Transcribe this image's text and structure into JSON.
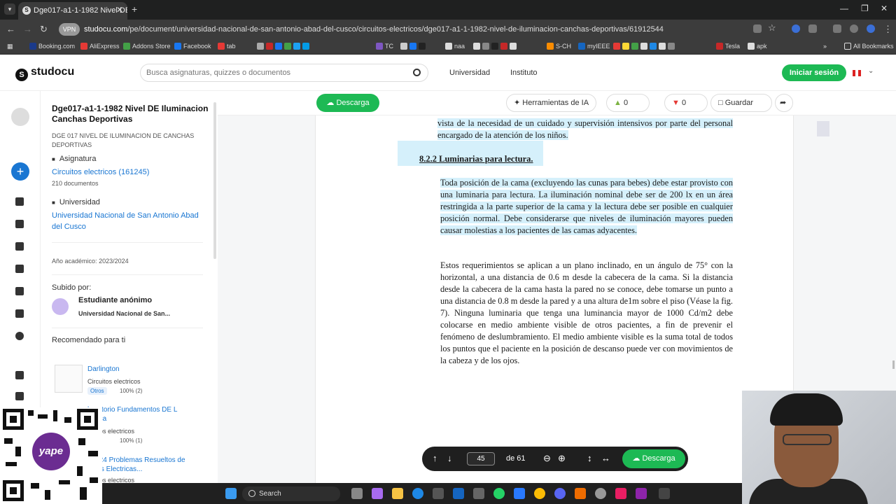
{
  "browser": {
    "tab_title": "Dge017-a1-1-1982 Nivel DE Ilu",
    "url_host": "studocu.com",
    "url_path": "/pe/document/universidad-nacional-de-san-antonio-abad-del-cusco/circuitos-electricos/dge017-a1-1-1982-nivel-de-iluminacion-canchas-deportivas/61912544",
    "vpn_label": "VPN",
    "bookmarks": [
      "Booking.com",
      "AliExpress",
      "Addons Store",
      "Facebook",
      "tab",
      "TC",
      "naa",
      "S-CH",
      "myIEEE",
      "Tesla",
      "apk"
    ],
    "all_bookmarks": "All Bookmarks"
  },
  "header": {
    "logo": "studocu",
    "search_placeholder": "Busca asignaturas, quizzes o documentos",
    "link_university": "Universidad",
    "link_institute": "Instituto",
    "login": "Iniciar sesión"
  },
  "sidebar": {
    "title": "Dge017-a1-1-1982 Nivel DE Iluminacion Canchas Deportivas",
    "subtitle": "DGE 017 NIVEL DE ILUMINACION DE CANCHAS DEPORTIVAS",
    "subject_label": "Asignatura",
    "subject": "Circuitos electricos (161245)",
    "doc_count": "210 documentos",
    "university_label": "Universidad",
    "university": "Universidad Nacional de San Antonio Abad del Cusco",
    "academic_year_label": "Año académico:",
    "academic_year": "2023/2024",
    "uploaded_by": "Subido por:",
    "uploader_name": "Estudiante anónimo",
    "uploader_uni": "Universidad Nacional de San...",
    "recommended": "Recomendado para ti",
    "rec_items": [
      {
        "title": "Darlington",
        "subject": "Circuitos electricos",
        "tag": "Otros",
        "pct": "100% (2)"
      },
      {
        "title": "boratorio Fundamentos DE L",
        "title2": "ronica",
        "subject": "rcuitos electricos",
        "tag": "os",
        "pct": "100% (1)"
      },
      {
        "title": "55024 Problemas Resueltos de",
        "title2": "uinas Electricas...",
        "subject": "rcuitos electricos"
      }
    ]
  },
  "doc_toolbar": {
    "download": "Descarga",
    "ai_tools": "Herramientas de IA",
    "likes": "0",
    "dislikes": "0",
    "save": "Guardar"
  },
  "page": {
    "para0": "vista de la necesidad de un cuidado y supervisión intensivos por parte del personal encargado de la atención de los niños.",
    "heading": "8.2.2 Luminarias para lectura.",
    "para1": "Toda posición de la cama (excluyendo las cunas para bebes) debe estar provisto con una luminaria para lectura. La iluminación nominal debe ser de 200 lx en un área restringida a la parte superior de la cama y la lectura debe ser posible en cualquier posición normal. Debe considerarse que niveles de iluminación mayores pueden causar molestias a los pacientes de las camas adyacentes.",
    "para2": "Estos requerimientos se aplican a un plano inclinado, en un ángulo de 75° con la horizontal, a una distancia de 0.6 m desde la cabecera de la cama. Si la distancia desde la cabecera de la cama hasta la pared no se conoce, debe tomarse un punto a una distancia de 0.8 m desde la pared y a una altura de1m sobre el piso (Véase la fig. 7). Ninguna luminaria que tenga una luminancia mayor de 1000 Cd/m2 debe colocarse en medio ambiente visible de otros pacientes, a fin de prevenir el fenómeno de deslumbramiento. El medio ambiente visible es la suma total de todos los puntos que el paciente en la posición de descanso puede ver con movimientos de la cabeza y de los ojos."
  },
  "pager": {
    "current_page": "45",
    "of_total": "de 61",
    "download": "Descarga"
  },
  "overlay": {
    "qr_brand": "yape"
  },
  "taskbar": {
    "search": "Search"
  }
}
